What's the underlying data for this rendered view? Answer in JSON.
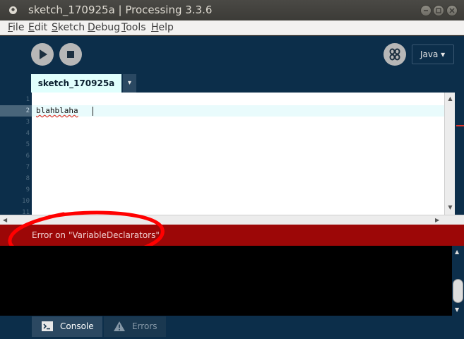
{
  "window": {
    "title": "sketch_170925a | Processing 3.3.6"
  },
  "menu": [
    "File",
    "Edit",
    "Sketch",
    "Debug",
    "Tools",
    "Help"
  ],
  "toolbar": {
    "mode_label": "Java ▾"
  },
  "tabs": {
    "active_label": "sketch_170925a",
    "menu_arrow": "▾"
  },
  "editor": {
    "line_numbers": [
      "1",
      "2",
      "3",
      "4",
      "5",
      "6",
      "7",
      "8",
      "9",
      "10",
      "11"
    ],
    "active_line": 2,
    "code_line_2": "blahblaha"
  },
  "error_bar": {
    "message": "Error on \"VariableDeclarators\""
  },
  "footer": {
    "console_label": "Console",
    "errors_label": "Errors"
  },
  "colors": {
    "background": "#0c2e4a",
    "editor_bg": "#ffffff",
    "error_bar": "#9c0707",
    "tab_active": "#e0fffd",
    "annotation_circle": "#ff0000"
  },
  "icons": [
    "app-icon",
    "minimize-icon",
    "maximize-icon",
    "close-icon",
    "run-icon",
    "stop-icon",
    "debug-icon",
    "terminal-icon",
    "warning-icon"
  ]
}
